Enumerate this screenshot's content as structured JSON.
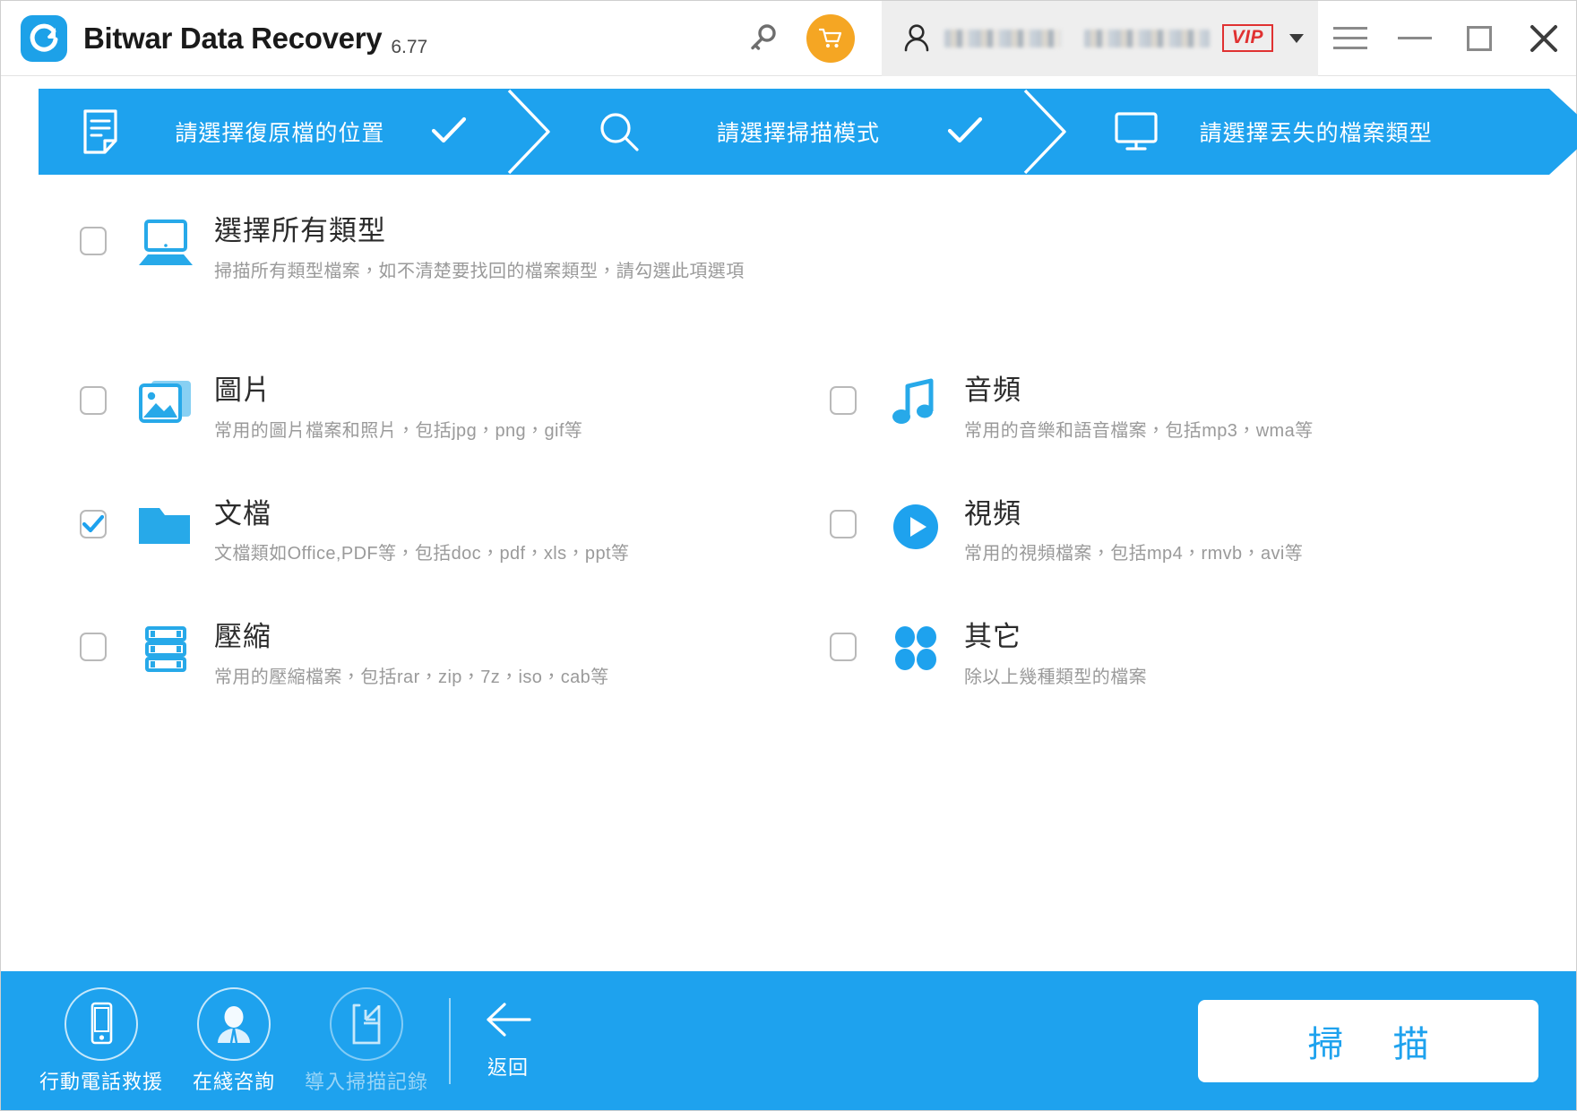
{
  "window": {
    "app_title": "Bitwar Data Recovery",
    "version": "6.77",
    "icons": {
      "logo": "bitwar-logo-icon",
      "key": "key-icon",
      "cart": "shopping-cart-icon",
      "user": "user-avatar-icon",
      "caret": "chevron-down-icon",
      "menu": "hamburger-menu-icon",
      "minimize": "minimize-icon",
      "maximize": "maximize-icon",
      "close": "close-icon"
    },
    "account": {
      "username_masked": "",
      "vip_label": "VIP"
    },
    "colors": {
      "brand_blue": "#1ea2ee",
      "cart_orange": "#f5a623",
      "vip_red": "#e03131",
      "account_panel_bg": "#eeeeee"
    }
  },
  "steps": [
    {
      "id": "step-location",
      "label": "請選擇復原檔的位置",
      "icon": "document-icon",
      "completed": true
    },
    {
      "id": "step-scan-mode",
      "label": "請選擇掃描模式",
      "icon": "search-icon",
      "completed": true
    },
    {
      "id": "step-file-type",
      "label": "請選擇丟失的檔案類型",
      "icon": "monitor-icon",
      "completed": false
    }
  ],
  "select_all": {
    "id": "select-all-types",
    "title": "選擇所有類型",
    "desc": "掃描所有類型檔案，如不清楚要找回的檔案類型，請勾選此項選項",
    "icon": "laptop-icon",
    "checked": false
  },
  "file_types": [
    {
      "id": "file-type-image",
      "title": "圖片",
      "desc": "常用的圖片檔案和照片，包括jpg，png，gif等",
      "icon": "photo-icon",
      "checked": false
    },
    {
      "id": "file-type-audio",
      "title": "音頻",
      "desc": "常用的音樂和語音檔案，包括mp3，wma等",
      "icon": "music-note-icon",
      "checked": false
    },
    {
      "id": "file-type-document",
      "title": "文檔",
      "desc": "文檔類如Office,PDF等，包括doc，pdf，xls，ppt等",
      "icon": "folder-icon",
      "checked": true
    },
    {
      "id": "file-type-video",
      "title": "視頻",
      "desc": "常用的視頻檔案，包括mp4，rmvb，avi等",
      "icon": "play-circle-icon",
      "checked": false
    },
    {
      "id": "file-type-archive",
      "title": "壓縮",
      "desc": "常用的壓縮檔案，包括rar，zip，7z，iso，cab等",
      "icon": "archive-icon",
      "checked": false
    },
    {
      "id": "file-type-other",
      "title": "其它",
      "desc": "除以上幾種類型的檔案",
      "icon": "four-dots-icon",
      "checked": false
    }
  ],
  "footer": {
    "tools": [
      {
        "id": "mobile-rescue",
        "label": "行動電話救援",
        "icon": "mobile-phone-icon",
        "disabled": false
      },
      {
        "id": "online-support",
        "label": "在綫咨詢",
        "icon": "support-agent-icon",
        "disabled": false
      },
      {
        "id": "import-scan-log",
        "label": "導入掃描記錄",
        "icon": "import-file-icon",
        "disabled": true
      }
    ],
    "back": {
      "label": "返回",
      "icon": "arrow-left-icon"
    },
    "scan_button": {
      "label": "掃 描"
    }
  }
}
